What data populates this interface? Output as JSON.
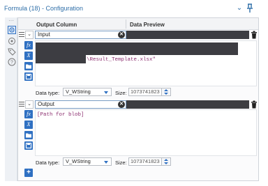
{
  "window": {
    "title": "Formula (18) - Configuration"
  },
  "grid": {
    "headers": {
      "output_column": "Output Column",
      "data_preview": "Data Preview"
    },
    "expressions": [
      {
        "output_field": "Input",
        "code_visible": "\\Result_Template.xlsx\"",
        "data_type_label": "Data type:",
        "data_type_value": "V_WString",
        "size_label": "Size:",
        "size_value": "1073741823"
      },
      {
        "output_field": "Output",
        "code_visible": "[Path for blob]",
        "data_type_label": "Data type:",
        "data_type_value": "V_WString",
        "size_label": "Size:",
        "size_value": "1073741823"
      }
    ]
  },
  "tools": {
    "function_label": "fx",
    "variable_label": "X",
    "clear_symbol": "✕"
  },
  "colors": {
    "accent": "#2f70c2",
    "title_text": "#2e6ea8",
    "code_text": "#8b2d6e",
    "redaction": "#3d3d42"
  }
}
